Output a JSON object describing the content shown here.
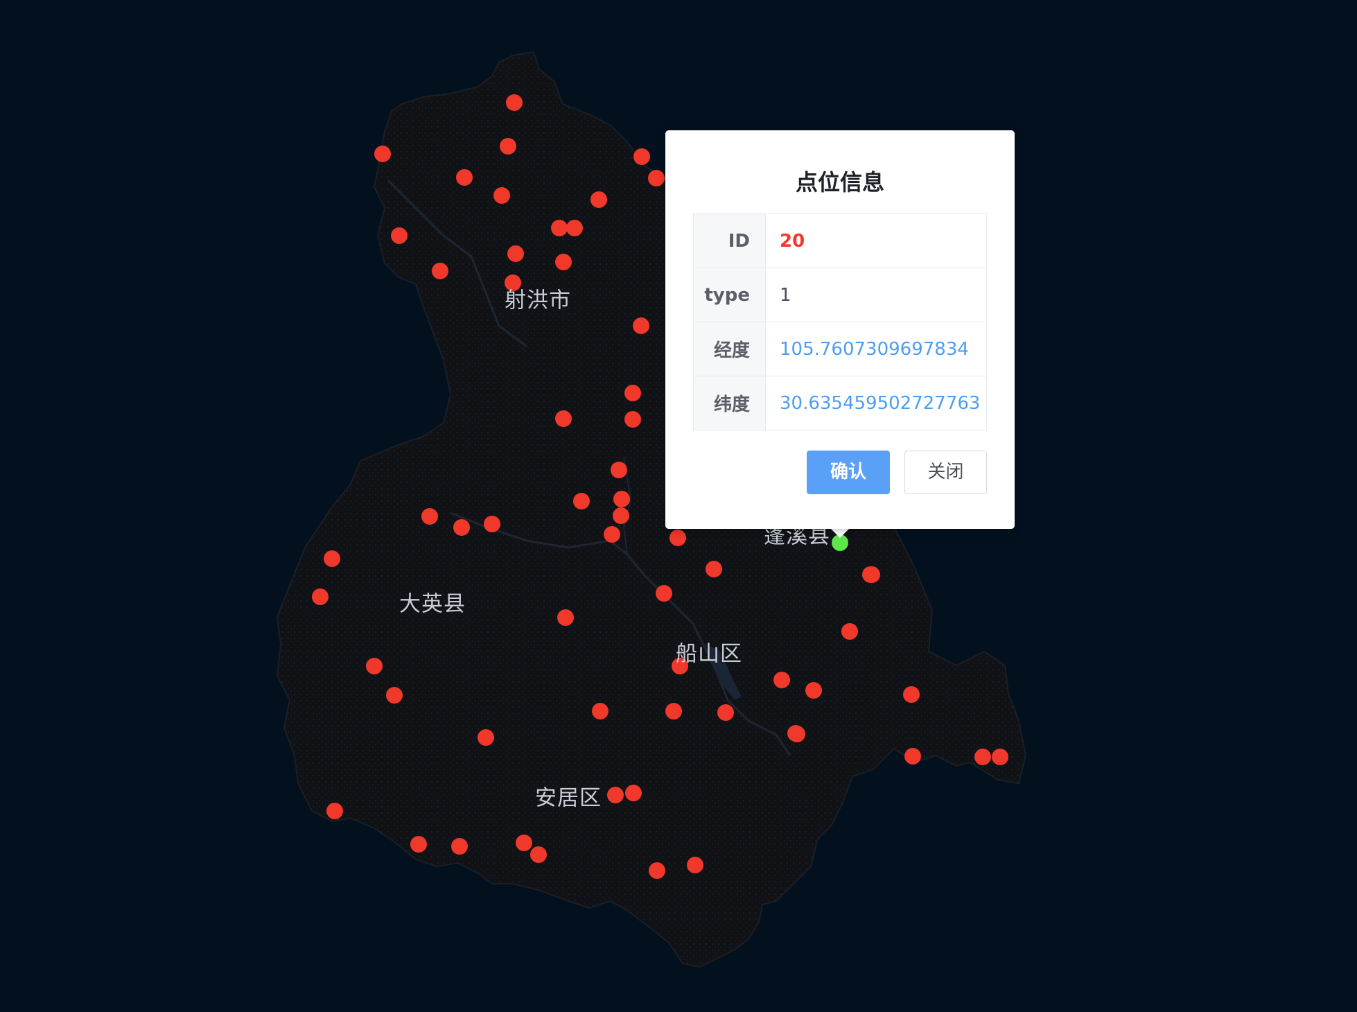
{
  "map": {
    "background_color": "#03111f",
    "region_fill_color": "#101216",
    "marker_color": "#f0382b",
    "selected_marker_color": "#5ee64a",
    "region_labels": [
      "射洪市",
      "大英县",
      "船山区",
      "安居区",
      "蓬溪县"
    ],
    "marker_count": 60,
    "selected_marker_count": 1
  },
  "popup": {
    "title": "点位信息",
    "rows": [
      {
        "key": "ID",
        "value": "20"
      },
      {
        "key": "type",
        "value": "1"
      },
      {
        "key": "经度",
        "value": "105.7607309697834"
      },
      {
        "key": "纬度",
        "value": "30.635459502727763"
      }
    ],
    "confirm_label": "确认",
    "close_label": "关闭",
    "confirm_color": "#5aa0f7"
  }
}
